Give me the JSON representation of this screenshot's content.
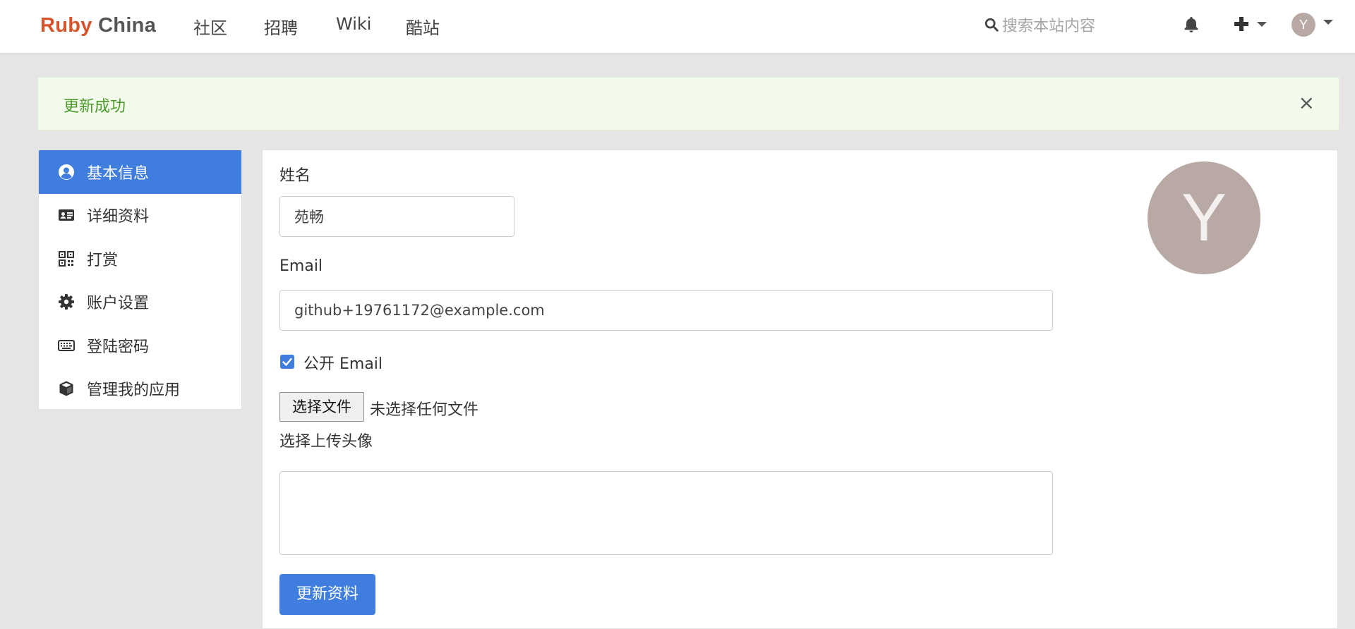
{
  "navbar": {
    "brand_part1": "Ruby",
    "brand_part2": "China",
    "links": [
      "社区",
      "招聘",
      "Wiki",
      "酷站"
    ],
    "search_placeholder": "搜索本站内容",
    "user_initial": "Y"
  },
  "alert": {
    "message": "更新成功",
    "close": "×"
  },
  "sidebar": {
    "items": [
      {
        "label": "基本信息",
        "icon": "user-circle-icon",
        "active": true
      },
      {
        "label": "详细资料",
        "icon": "id-card-icon",
        "active": false
      },
      {
        "label": "打赏",
        "icon": "qrcode-icon",
        "active": false
      },
      {
        "label": "账户设置",
        "icon": "gear-icon",
        "active": false
      },
      {
        "label": "登陆密码",
        "icon": "keyboard-icon",
        "active": false
      },
      {
        "label": "管理我的应用",
        "icon": "cube-icon",
        "active": false
      }
    ]
  },
  "form": {
    "name_label": "姓名",
    "name_value": "苑畅",
    "email_label": "Email",
    "email_value": "github+19761172@example.com",
    "public_email_label": "公开 Email",
    "public_email_checked": true,
    "file_button": "选择文件",
    "file_status": "未选择任何文件",
    "avatar_hint": "选择上传头像",
    "bio_value": "",
    "submit_label": "更新资料",
    "avatar_initial": "Y"
  },
  "colors": {
    "brand_ruby": "#d6542b",
    "primary": "#3f7ede",
    "success_text": "#4e9a2b",
    "success_bg": "#f2faec",
    "avatar_bg": "#b9a9a4"
  }
}
